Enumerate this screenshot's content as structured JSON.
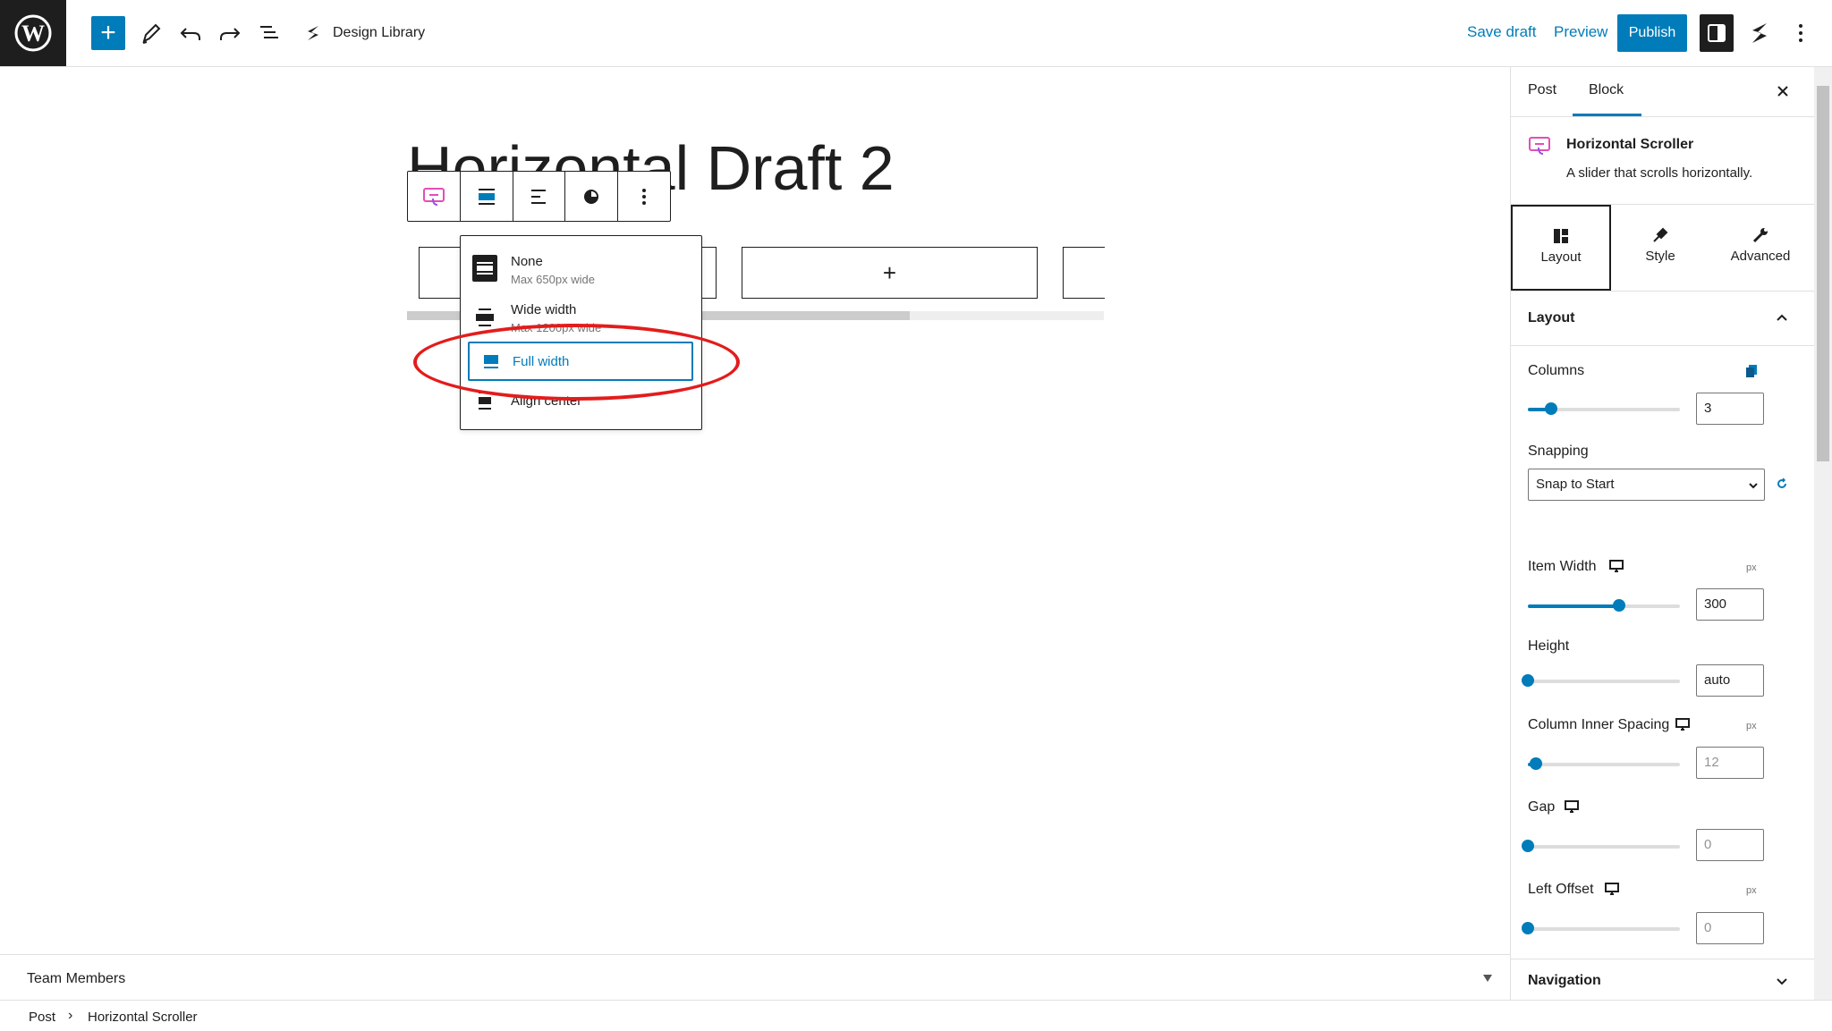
{
  "topbar": {
    "design_library_label": "Design Library",
    "save_draft_label": "Save draft",
    "preview_label": "Preview",
    "publish_label": "Publish",
    "colors": {
      "accent": "#007cba",
      "dark": "#1e1e1e"
    }
  },
  "editor": {
    "post_title": "Horizontal Draft 2",
    "add_column_symbol": "+"
  },
  "align_menu": {
    "items": [
      {
        "label": "None",
        "description": "Max 650px wide"
      },
      {
        "label": "Wide width",
        "description": "Max 1200px wide"
      },
      {
        "label": "Full width",
        "description": ""
      },
      {
        "label": "Align center",
        "description": ""
      }
    ],
    "selected": "Full width",
    "annotation_color": "#e31c1c"
  },
  "sidebar": {
    "tabs": [
      "Post",
      "Block"
    ],
    "active_tab": "Block",
    "block_name": "Horizontal Scroller",
    "block_description": "A slider that scrolls horizontally.",
    "panel_tabs": [
      "Layout",
      "Style",
      "Advanced"
    ],
    "active_panel_tab": "Layout",
    "section_title": "Layout",
    "columns": {
      "label": "Columns",
      "value": "3",
      "slider_fraction": 0.15
    },
    "snapping": {
      "label": "Snapping",
      "value": "Snap to Start"
    },
    "item_width": {
      "label": "Item Width",
      "unit": "px",
      "value": "300",
      "slider_fraction": 0.6
    },
    "height": {
      "label": "Height",
      "value": "auto",
      "slider_fraction": 0.0
    },
    "column_inner_spacing": {
      "label": "Column Inner Spacing",
      "unit": "px",
      "value": "12",
      "slider_fraction": 0.05
    },
    "gap": {
      "label": "Gap",
      "value": "0",
      "slider_fraction": 0.0
    },
    "left_offset": {
      "label": "Left Offset",
      "unit": "px",
      "value": "0",
      "slider_fraction": 0.0
    },
    "navigation_label": "Navigation"
  },
  "bottom_panel": {
    "title": "Team Members"
  },
  "breadcrumb": {
    "items": [
      "Post",
      "Horizontal Scroller"
    ],
    "separator": "›"
  }
}
